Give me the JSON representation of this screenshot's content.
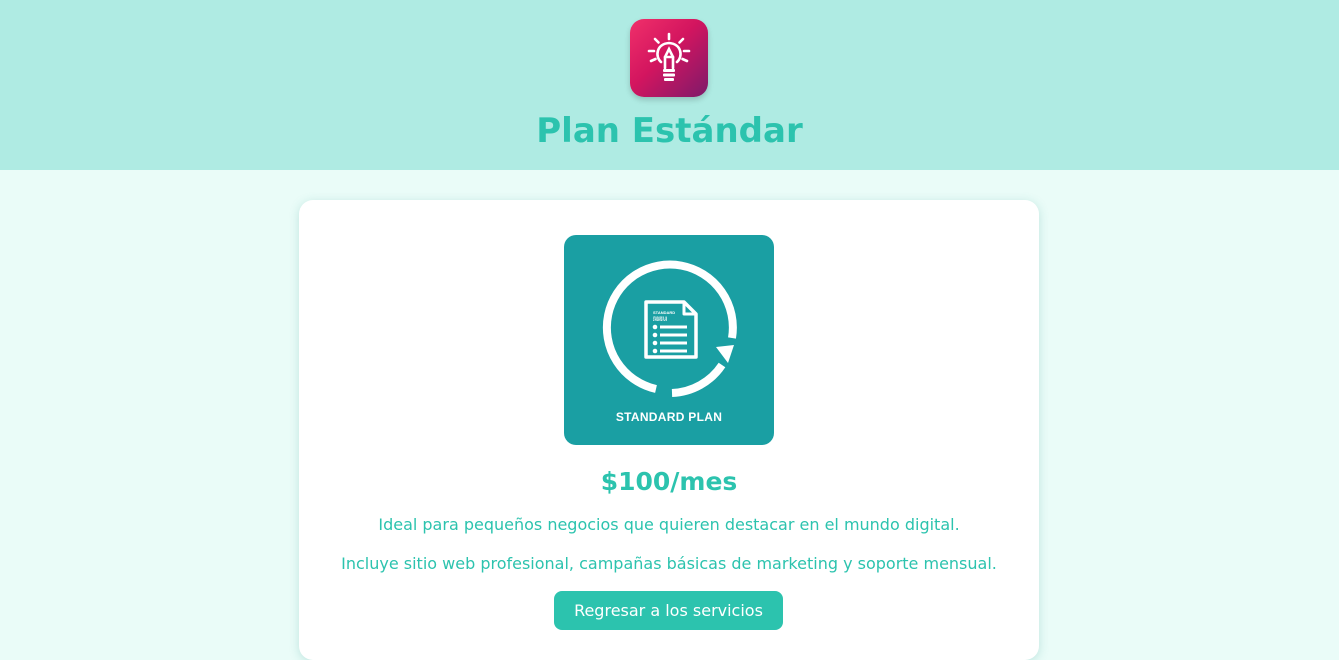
{
  "header": {
    "title": "Plan Estándar",
    "logo_icon": "lightbulb-pencil-icon",
    "background": "#afebe3"
  },
  "card": {
    "image": {
      "icon": "document-cycle-icon",
      "doc_label": "STANDARD PLAN",
      "caption": "STANDARD PLAN",
      "background": "#1a9fa3"
    },
    "price": "$100/mes",
    "description_1": "Ideal para pequeños negocios que quieren destacar en el mundo digital.",
    "description_2": "Incluye sitio web profesional, campañas básicas de marketing y soporte mensual.",
    "button_label": "Regresar a los servicios"
  },
  "colors": {
    "accent": "#2cc3ae",
    "page_background": "#eafcf8",
    "logo_gradient_start": "#f0306a",
    "logo_gradient_end": "#7d1a6a"
  }
}
